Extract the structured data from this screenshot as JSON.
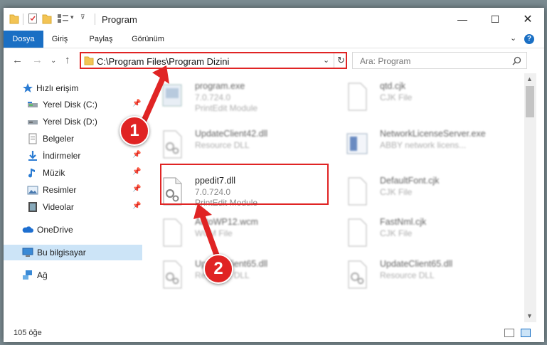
{
  "window": {
    "title": "Program"
  },
  "ribbon": {
    "tabs": [
      "Dosya",
      "Giriş",
      "Paylaş",
      "Görünüm"
    ]
  },
  "address": {
    "path": "C:\\Program Files\\Program Dizini"
  },
  "search": {
    "placeholder": "Ara: Program"
  },
  "sidebar": {
    "items": [
      {
        "label": "Hızlı erişim",
        "icon": "star-icon"
      },
      {
        "label": "Yerel Disk (C:)",
        "icon": "drive-icon",
        "pinned": true
      },
      {
        "label": "Yerel Disk (D:)",
        "icon": "drive-icon",
        "pinned": false
      },
      {
        "label": "Belgeler",
        "icon": "documents-icon",
        "pinned": false
      },
      {
        "label": "İndirmeler",
        "icon": "download-icon",
        "pinned": true
      },
      {
        "label": "Müzik",
        "icon": "music-icon",
        "pinned": true
      },
      {
        "label": "Resimler",
        "icon": "pictures-icon",
        "pinned": true
      },
      {
        "label": "Videolar",
        "icon": "videos-icon",
        "pinned": true
      },
      {
        "label": "OneDrive",
        "icon": "cloud-icon"
      },
      {
        "label": "Bu bilgisayar",
        "icon": "computer-icon",
        "selected": true
      },
      {
        "label": "Ağ",
        "icon": "network-icon"
      }
    ]
  },
  "files": [
    {
      "name": "program.exe",
      "line2": "7.0.724.0",
      "line3": "PrintEdit Module",
      "icon": "exe-icon"
    },
    {
      "name": "qtd.cjk",
      "line2": "CJK File",
      "line3": "",
      "icon": "file-icon"
    },
    {
      "name": "UpdateClient42.dll",
      "line2": "Resource DLL",
      "line3": "",
      "icon": "dll-icon"
    },
    {
      "name": "NetworkLicenseServer.exe",
      "line2": "ABBY network licens...",
      "line3": "",
      "icon": "app-icon"
    },
    {
      "name": "ppedit7.dll",
      "line2": "7.0.724.0",
      "line3": "PrintEdit Module",
      "icon": "dll-icon"
    },
    {
      "name": "DefaultFont.cjk",
      "line2": "CJK File",
      "line3": "",
      "icon": "file-icon"
    },
    {
      "name": "AutoWP12.wcm",
      "line2": "WCM File",
      "line3": "",
      "icon": "file-icon"
    },
    {
      "name": "FastNml.cjk",
      "line2": "CJK File",
      "line3": "",
      "icon": "file-icon"
    },
    {
      "name": "UpdateClient65.dll",
      "line2": "Resource DLL",
      "line3": "",
      "icon": "dll-icon"
    },
    {
      "name": "UpdateClient65.dll",
      "line2": "Resource DLL",
      "line3": "",
      "icon": "dll-icon"
    }
  ],
  "status": {
    "count": "105 öğe"
  },
  "callouts": {
    "one": "1",
    "two": "2"
  },
  "colors": {
    "accent": "#1a6fc4",
    "highlight": "#e02424",
    "selection": "#cce4f7"
  }
}
